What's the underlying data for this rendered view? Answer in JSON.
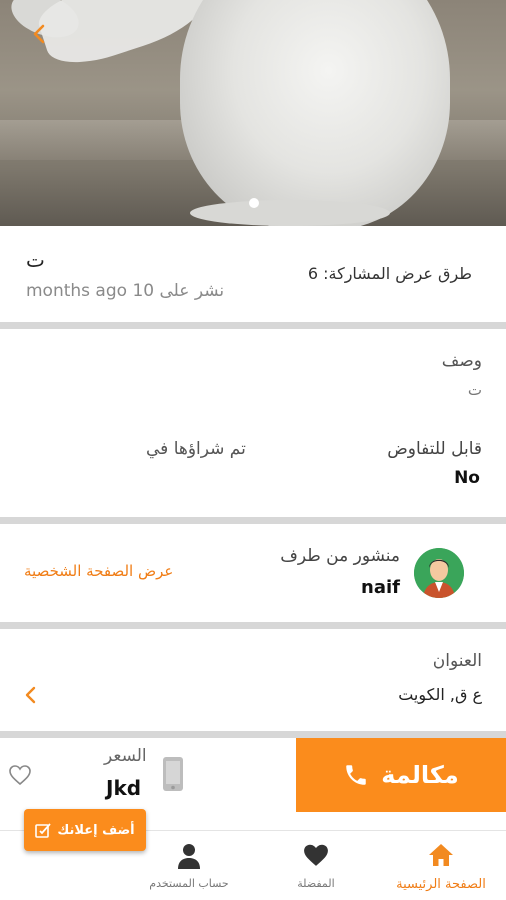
{
  "listing": {
    "title": "ت",
    "posted": "نشر على 10 months ago",
    "share_views": "طرق عرض المشاركة: 6",
    "description_label": "وصف",
    "description_value": "ت",
    "negotiable_label": "قابل للتفاوض",
    "negotiable_value": "No",
    "bought_in_label": "تم شراؤها في",
    "address_label": "العنوان",
    "address_value": "ع ق, الكويت"
  },
  "seller": {
    "posted_by_label": "منشور من طرف",
    "name": "naif",
    "view_profile": "عرض الصفحة الشخصية"
  },
  "actions": {
    "call_label": "مكالمة",
    "price_label": "السعر",
    "price_value": "Jkd",
    "add_ad_label": "أضف إعلانك"
  },
  "bottom_nav": {
    "home": "الصفحة الرئيسية",
    "favorites": "المفضلة",
    "account": "حساب المستخدم"
  },
  "colors": {
    "accent": "#fb8c1c",
    "link": "#f07d16"
  },
  "icons": [
    "back-arrow-icon",
    "phone-icon",
    "mobile-icon",
    "heart-outline-icon",
    "add-ad-icon",
    "home-icon",
    "heart-icon",
    "user-icon",
    "chevron-left-icon"
  ]
}
